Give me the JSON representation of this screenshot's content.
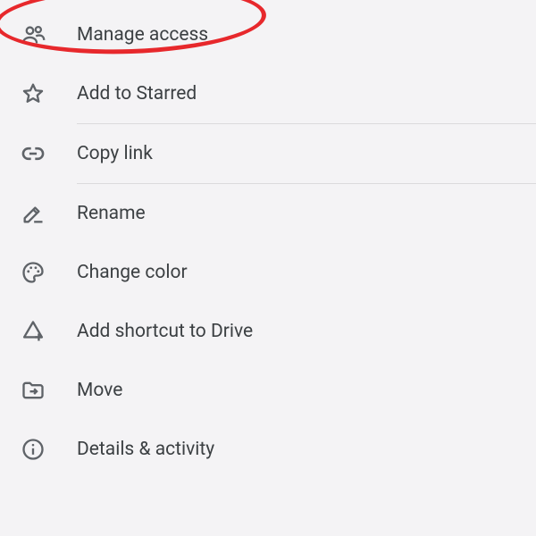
{
  "menu": {
    "items": [
      {
        "icon": "people-icon",
        "label": "Manage access"
      },
      {
        "icon": "star-icon",
        "label": "Add to Starred"
      },
      {
        "icon": "link-icon",
        "label": "Copy link"
      },
      {
        "icon": "rename-icon",
        "label": "Rename"
      },
      {
        "icon": "palette-icon",
        "label": "Change color"
      },
      {
        "icon": "shortcut-icon",
        "label": "Add shortcut to Drive"
      },
      {
        "icon": "move-icon",
        "label": "Move"
      },
      {
        "icon": "info-icon",
        "label": "Details & activity"
      }
    ]
  },
  "annotation": {
    "highlighted_item": "Manage access",
    "highlight_color": "#e7282c"
  }
}
